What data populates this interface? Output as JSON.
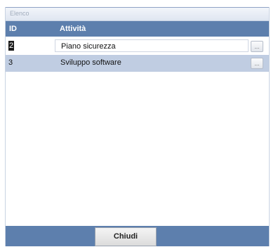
{
  "window": {
    "title": "Elenco"
  },
  "grid": {
    "columns": {
      "id": "ID",
      "activity": "Attività"
    },
    "rows": [
      {
        "id": "2",
        "activity": "Piano sicurezza",
        "action_label": "..."
      },
      {
        "id": "3",
        "activity": "Sviluppo software",
        "action_label": "..."
      }
    ]
  },
  "footer": {
    "close_label": "Chiudi"
  },
  "colors": {
    "header_background": "#5d7fad",
    "selected_row_background": "#c0cde2"
  }
}
